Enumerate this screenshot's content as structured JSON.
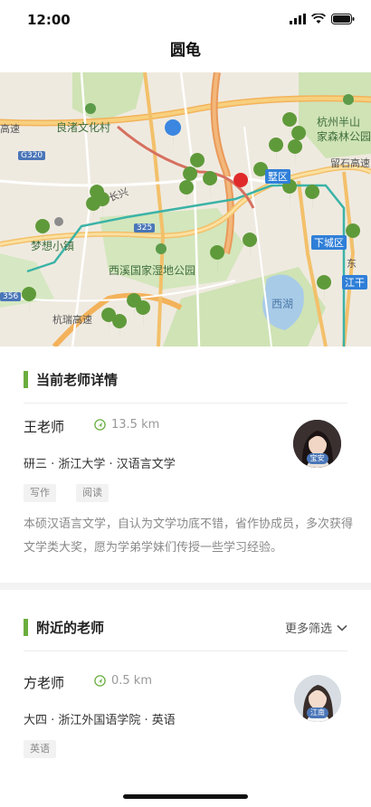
{
  "status_bar": {
    "time": "12:00"
  },
  "nav": {
    "title": "圆龟"
  },
  "map": {
    "labels": {
      "liangzhu": "良渚文化村",
      "hangzhou_park": "杭州半山国家森林公园",
      "hangzhou_park_line2": "家森林公园",
      "hangzhou_park_line1": "杭州半山",
      "dream_town": "梦想小镇",
      "xixi": "西溪国家湿地公园",
      "xihu": "西湖",
      "gaosu_left": "高速",
      "hanghuang": "杭瑞高速",
      "changzhi": "长兴",
      "g320": "G320",
      "s356": "356",
      "g325": "325",
      "shuangbaqiao": "留石高速",
      "dong": "东",
      "xiacheng": "下城区",
      "jianggan": "江干",
      "gongshu": "墅区"
    }
  },
  "current": {
    "section_title": "当前老师详情",
    "name": "王老师",
    "distance": "13.5 km",
    "info": "研三 · 浙江大学 · 汉语言文学",
    "tags": [
      "写作",
      "阅读"
    ],
    "avatar_badge": "宝安",
    "description": "本硕汉语言文学，自认为文学功底不错，省作协成员，多次获得文学类大奖，愿为学弟学妹们传授一些学习经验。"
  },
  "nearby": {
    "section_title": "附近的老师",
    "filter_label": "更多筛选",
    "teacher": {
      "name": "方老师",
      "distance": "0.5 km",
      "info": "大四 · 浙江外国语学院 · 英语",
      "tags": [
        "英语"
      ],
      "avatar_badge": "江南"
    }
  },
  "colors": {
    "accent": "#6aae3e",
    "pin_green": "#5f9a3a",
    "pin_red": "#e02a2a",
    "pin_blue": "#3a86e0"
  }
}
